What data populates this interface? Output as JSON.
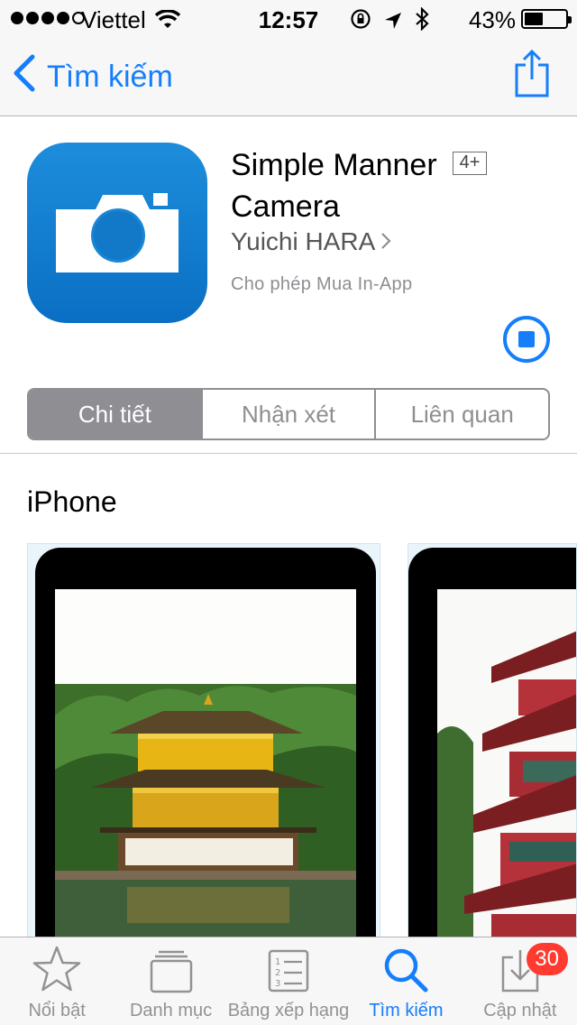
{
  "status_bar": {
    "carrier": "Viettel",
    "time": "12:57",
    "battery": "43%",
    "battery_level": 0.43,
    "icons": [
      "signal-icon",
      "wifi-icon",
      "orientation-lock-icon",
      "location-icon",
      "bluetooth-icon",
      "battery-icon"
    ]
  },
  "nav": {
    "back_label": "Tìm kiếm",
    "share_icon": "share-icon"
  },
  "app": {
    "name": "Simple Manner Camera",
    "age_rating": "4+",
    "developer": "Yuichi HARA",
    "in_app": "Cho phép Mua In-App",
    "download_state": "stop-download-icon",
    "icon_color": "#1a86d6"
  },
  "segments": {
    "items": [
      "Chi tiết",
      "Nhận xét",
      "Liên quan"
    ],
    "selected": 0
  },
  "screenshots": {
    "section_title": "iPhone"
  },
  "tabbar": {
    "items": [
      {
        "label": "Nổi bật",
        "icon": "star-icon"
      },
      {
        "label": "Danh mục",
        "icon": "categories-icon"
      },
      {
        "label": "Bảng xếp hạng",
        "icon": "top-charts-icon"
      },
      {
        "label": "Tìm kiếm",
        "icon": "search-icon"
      },
      {
        "label": "Cập nhật",
        "icon": "updates-icon",
        "badge": "30"
      }
    ],
    "active": 3
  },
  "colors": {
    "accent": "#157efb",
    "badge": "#ff3b30",
    "segment_active": "#8e8e93"
  }
}
